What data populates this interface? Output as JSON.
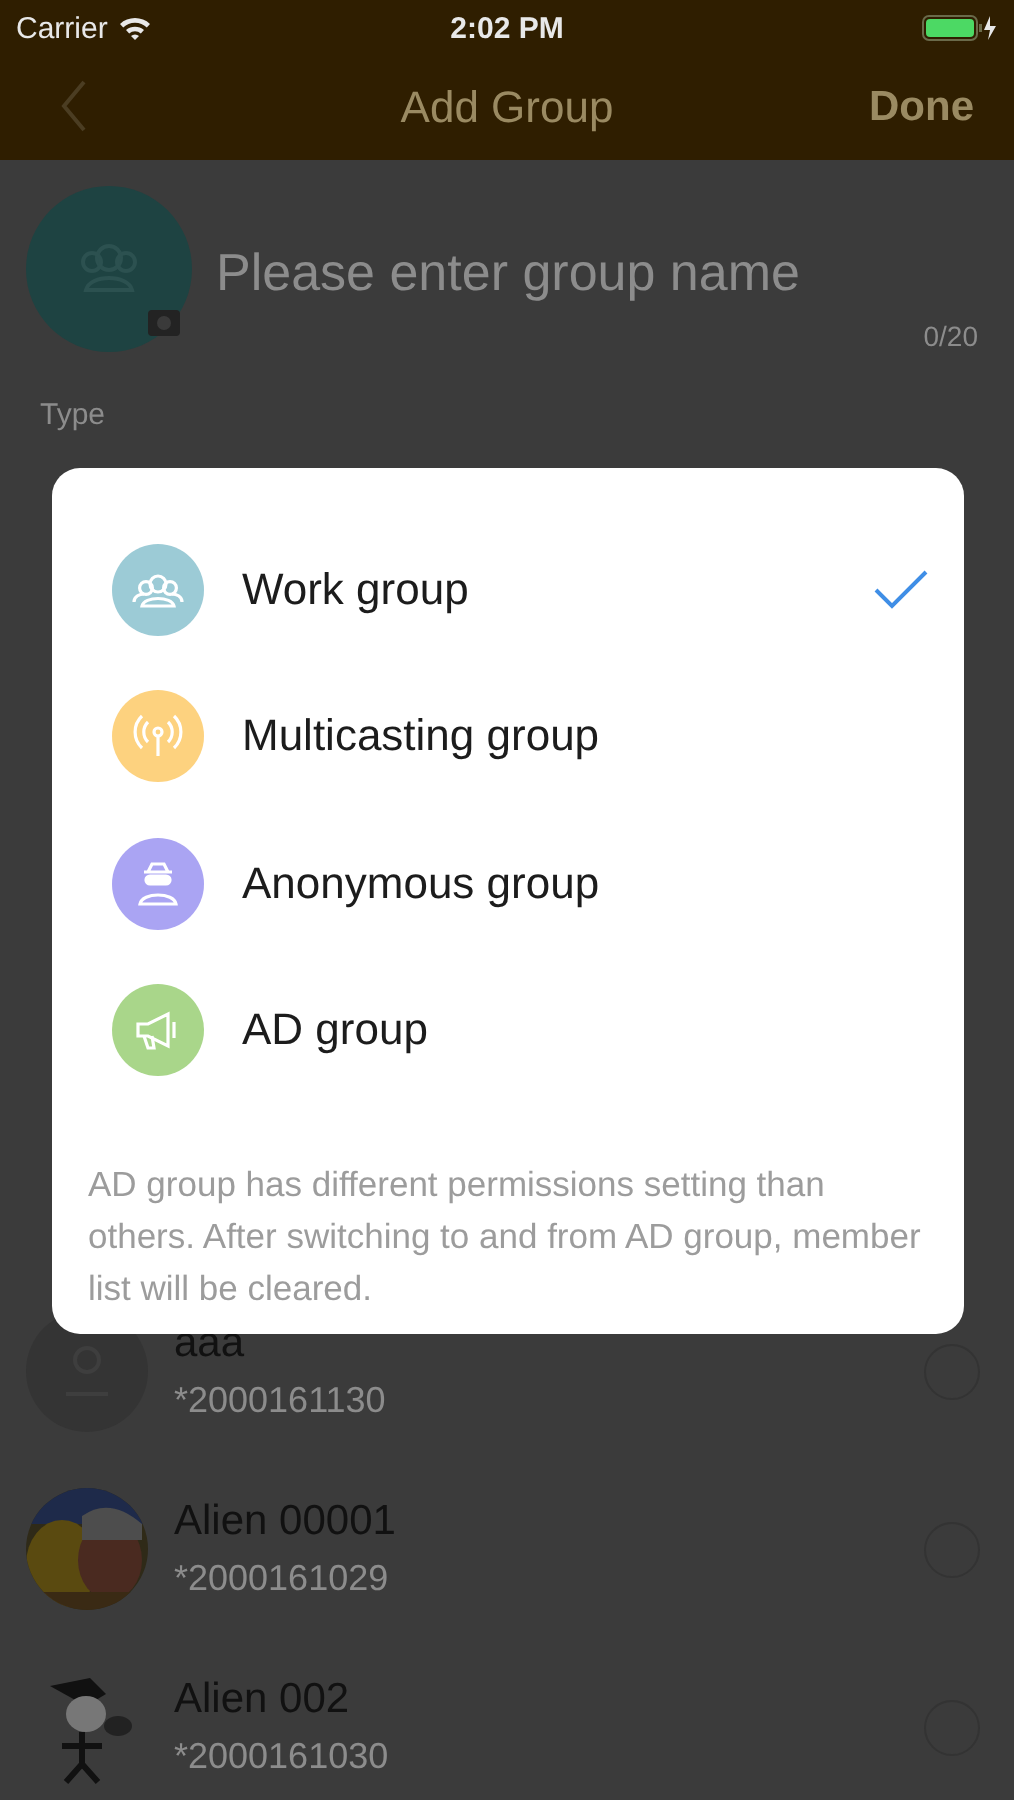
{
  "status_bar": {
    "carrier": "Carrier",
    "time": "2:02 PM"
  },
  "nav": {
    "title": "Add Group",
    "action": "Done"
  },
  "group_name": {
    "placeholder": "Please enter group name",
    "counter": "0/20"
  },
  "type_label": "Type",
  "members": [
    {
      "name": "aaa",
      "id": "*2000161130",
      "kind": "placeholder",
      "selected": false
    },
    {
      "name": "Alien 00001",
      "id": "*2000161029",
      "kind": "picture",
      "selected": false
    },
    {
      "name": "Alien 002",
      "id": "*2000161030",
      "kind": "sketch",
      "selected": false
    }
  ],
  "dialog": {
    "options": [
      {
        "label": "Work group",
        "kind": "work",
        "color": "#9ccbd6",
        "selected": true
      },
      {
        "label": "Multicasting group",
        "kind": "multicast",
        "color": "#fdd27f",
        "selected": false
      },
      {
        "label": "Anonymous group",
        "kind": "anonymous",
        "color": "#aaa4f3",
        "selected": false
      },
      {
        "label": "AD group",
        "kind": "ad",
        "color": "#a9d68a",
        "selected": false
      }
    ],
    "note": "AD group has different permissions setting than others. After switching to and from AD group, member list will be cleared."
  }
}
